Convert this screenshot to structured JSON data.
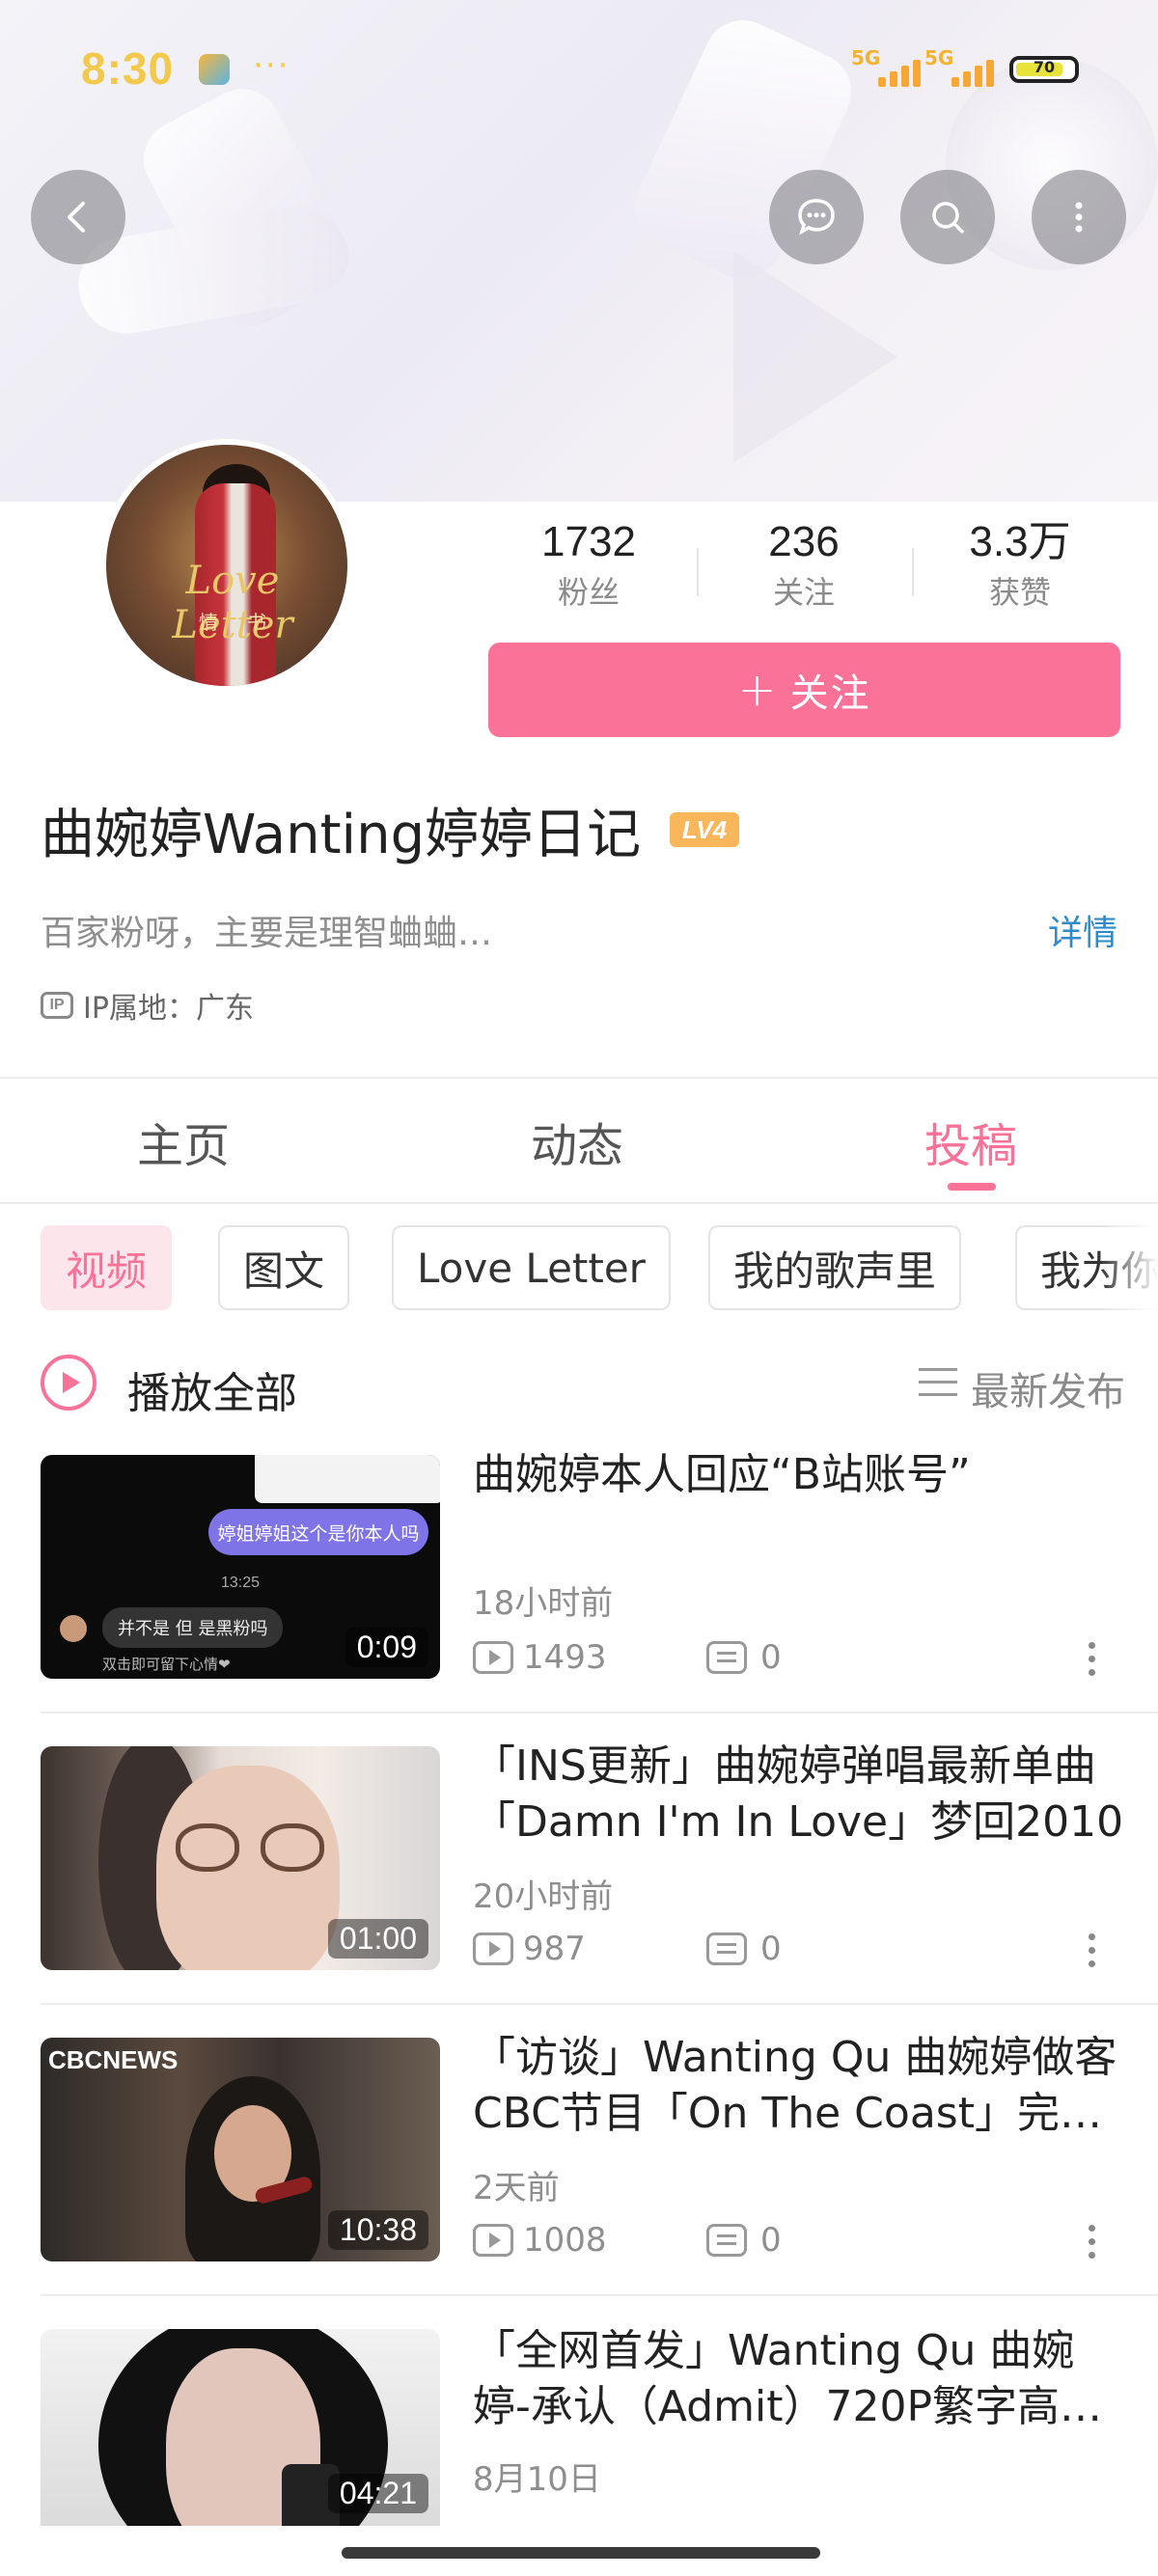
{
  "status_bar": {
    "time": "8:30",
    "dots": "···",
    "network_1": "5G",
    "network_2": "5G",
    "battery": "70"
  },
  "profile": {
    "avatar_title_script": "Love Letter",
    "avatar_title_cn": "情书",
    "stats": [
      {
        "value": "1732",
        "label": "粉丝"
      },
      {
        "value": "236",
        "label": "关注"
      },
      {
        "value": "3.3万",
        "label": "获赞"
      }
    ],
    "follow_plus": "+",
    "follow_label": "关注",
    "username": "曲婉婷Wanting婷婷日记",
    "level_badge": "LV4",
    "bio": "百家粉呀，主要是理智蛐蛐…",
    "detail_link": "详情",
    "ip_icon": "IP",
    "ip_location": "IP属地：广东"
  },
  "tabs": [
    {
      "label": "主页",
      "active": false
    },
    {
      "label": "动态",
      "active": false
    },
    {
      "label": "投稿",
      "active": true
    }
  ],
  "chips": [
    {
      "label": "视频",
      "active": true
    },
    {
      "label": "图文",
      "active": false
    },
    {
      "label": "Love Letter",
      "active": false
    },
    {
      "label": "我的歌声里",
      "active": false
    },
    {
      "label": "我为你",
      "active": false
    }
  ],
  "play_all": "播放全部",
  "sort_label": "最新发布",
  "colors": {
    "accent": "#fb7299",
    "link": "#2e8bc9",
    "level": "#f9b65a",
    "time_yellow": "#f2c94c"
  },
  "videos": [
    {
      "title": "曲婉婷本人回应“B站账号”",
      "time": "18小时前",
      "views": "1493",
      "comments": "0",
      "duration": "0:09",
      "thumb_bubble": "婷姐婷姐这个是你本人吗",
      "thumb_time": "13:25",
      "thumb_reply": "并不是 但 是黑粉吗",
      "thumb_hint": "双击即可留下心情❤"
    },
    {
      "title": "「INS更新」曲婉婷弹唱最新单曲「Damn I'm In Love」梦回2010",
      "time": "20小时前",
      "views": "987",
      "comments": "0",
      "duration": "01:00"
    },
    {
      "title": "「访谈」Wanting Qu 曲婉婷做客CBC节目「On The Coast」完…",
      "time": "2天前",
      "views": "1008",
      "comments": "0",
      "duration": "10:38",
      "thumb_logo": "CBCNEWS"
    },
    {
      "title": "「全网首发」Wanting Qu 曲婉婷-承认（Admit）720P繁字高…",
      "time": "8月10日",
      "views": "",
      "comments": "",
      "duration": "04:21"
    }
  ]
}
